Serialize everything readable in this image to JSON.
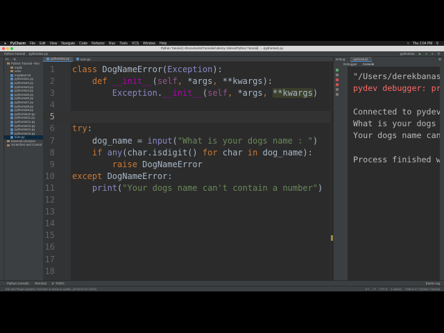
{
  "menubar": {
    "app": "PyCharm",
    "items": [
      "File",
      "Edit",
      "View",
      "Navigate",
      "Code",
      "Refactor",
      "Run",
      "Tools",
      "VCS",
      "Window",
      "Help"
    ],
    "clock": "Thu 2:04 PM"
  },
  "window": {
    "title": "Python Tutorial [~/Documents/Tutorials/Udemy Videos/Python Tutorial] - .../pythontut1.py"
  },
  "nav": {
    "project": "Python Tutorial",
    "file": "pythontut1.py",
    "run_config": "pythontut1"
  },
  "project": {
    "header": "Pr...",
    "items": [
      {
        "label": "Python Tutorial ~/Do",
        "type": "folder",
        "indent": 0
      },
      {
        "label": "mydir",
        "type": "folder",
        "indent": 1
      },
      {
        "label": "venv",
        "type": "folder",
        "indent": 1
      },
      {
        "label": "mydata2.txt",
        "type": "file",
        "indent": 1
      },
      {
        "label": "pythontut1.py",
        "type": "file",
        "indent": 1
      },
      {
        "label": "pythontut2.py",
        "type": "file",
        "indent": 1
      },
      {
        "label": "pythontut3.py",
        "type": "file",
        "indent": 1
      },
      {
        "label": "pythontut4.py",
        "type": "file",
        "indent": 1
      },
      {
        "label": "pythontut5.py",
        "type": "file",
        "indent": 1
      },
      {
        "label": "pythontut6.py",
        "type": "file",
        "indent": 1
      },
      {
        "label": "pythontut7.py",
        "type": "file",
        "indent": 1
      },
      {
        "label": "pythontut8.py",
        "type": "file",
        "indent": 1
      },
      {
        "label": "pythontut9.py",
        "type": "file",
        "indent": 1
      },
      {
        "label": "pythontut10.py",
        "type": "file",
        "indent": 1
      },
      {
        "label": "pythontut11.py",
        "type": "file",
        "indent": 1
      },
      {
        "label": "pythontut12.py",
        "type": "file",
        "indent": 1
      },
      {
        "label": "pythontut13.py",
        "type": "file",
        "indent": 1
      },
      {
        "label": "pythontut14.py",
        "type": "file",
        "indent": 1
      },
      {
        "label": "pythontut15.py",
        "type": "file",
        "indent": 1
      },
      {
        "label": "sum.py",
        "type": "file",
        "indent": 1,
        "selected": true
      },
      {
        "label": "External Libraries",
        "type": "folder",
        "indent": 0
      },
      {
        "label": "Scratches and Consol",
        "type": "folder",
        "indent": 0
      }
    ]
  },
  "tabs": [
    {
      "label": "pythontut1.py",
      "active": true
    },
    {
      "label": "sum.py",
      "active": false
    }
  ],
  "colors": {
    "kw": "#cc7832",
    "tx": "#a9b7c6",
    "self": "#94558d",
    "bi": "#8888c6",
    "magic": "#b200b2",
    "str": "#6a8759"
  },
  "code": [
    [
      [
        "kw",
        "class "
      ],
      [
        "tx",
        "DogNameError("
      ],
      [
        "bi",
        "Exception"
      ],
      [
        "tx",
        "):"
      ]
    ],
    [
      [
        "tx",
        "    "
      ],
      [
        "kw",
        "def "
      ],
      [
        "magic",
        "__init__"
      ],
      [
        "tx",
        "("
      ],
      [
        "self",
        "self"
      ],
      [
        "kw",
        ", "
      ],
      [
        "tx",
        "*args"
      ],
      [
        "kw",
        ", "
      ],
      [
        "tx",
        "**kwargs):"
      ]
    ],
    [
      [
        "tx",
        "        "
      ],
      [
        "bi",
        "Exception"
      ],
      [
        "tx",
        "."
      ],
      [
        "magic",
        "__init__"
      ],
      [
        "tx",
        "("
      ],
      [
        "self",
        "self"
      ],
      [
        "kw",
        ", "
      ],
      [
        "tx",
        "*args"
      ],
      [
        "kw",
        ", "
      ],
      [
        "sel",
        "**kwargs"
      ],
      [
        "tx",
        ")"
      ]
    ],
    [],
    [],
    [
      [
        "kw",
        "try"
      ],
      [
        "tx",
        ":"
      ]
    ],
    [
      [
        "tx",
        "    dog_name = "
      ],
      [
        "bi",
        "input"
      ],
      [
        "tx",
        "("
      ],
      [
        "str",
        "\"What is your dogs name : \""
      ],
      [
        "tx",
        ")"
      ]
    ],
    [
      [
        "tx",
        "    "
      ],
      [
        "kw",
        "if "
      ],
      [
        "bi",
        "any"
      ],
      [
        "tx",
        "(char.isdigit() "
      ],
      [
        "kw",
        "for "
      ],
      [
        "tx",
        "char "
      ],
      [
        "kw",
        "in "
      ],
      [
        "tx",
        "dog_name):"
      ]
    ],
    [
      [
        "tx",
        "        "
      ],
      [
        "kw",
        "raise "
      ],
      [
        "tx",
        "DogNameError"
      ]
    ],
    [
      [
        "kw",
        "except "
      ],
      [
        "tx",
        "DogNameError:"
      ]
    ],
    [
      [
        "tx",
        "    "
      ],
      [
        "bi",
        "print"
      ],
      [
        "tx",
        "("
      ],
      [
        "str",
        "\"Your dogs name can't contain a number\""
      ],
      [
        "tx",
        ")"
      ]
    ],
    [],
    [],
    [],
    [],
    [],
    [],
    []
  ],
  "current_line": 5,
  "debug": {
    "label": "Debug:",
    "tab": "pythontut1",
    "subtabs": [
      "Debugger",
      "Console"
    ],
    "console": [
      {
        "text": "\"/Users/derekbanas",
        "color": "#bbbbbb"
      },
      {
        "text": "pydev debugger: pr",
        "color": "#ff6b68"
      },
      {
        "text": "",
        "color": "#bbbbbb"
      },
      {
        "text": "Connected to pydev",
        "color": "#bbbbbb"
      },
      {
        "text": "What is your dogs ",
        "color": "#bbbbbb"
      },
      {
        "text": "Your dogs name can",
        "color": "#bbbbbb"
      },
      {
        "text": "",
        "color": "#bbbbbb"
      },
      {
        "text": "Process finished w",
        "color": "#bbbbbb"
      }
    ]
  },
  "toolwindows": {
    "python_console": "Python Console",
    "terminal": "Terminal",
    "todo": "6: TODO",
    "event_log": "Event Log"
  },
  "status": {
    "message": "IDE and Plugin Updates: PyCharm is ready to update. (2018-09-03 15:53)",
    "pos": "6:1",
    "le": "LF",
    "enc": "UTF-8",
    "indent": "4 spaces",
    "interp": "Python 3.7 (Python Tutorial)"
  }
}
